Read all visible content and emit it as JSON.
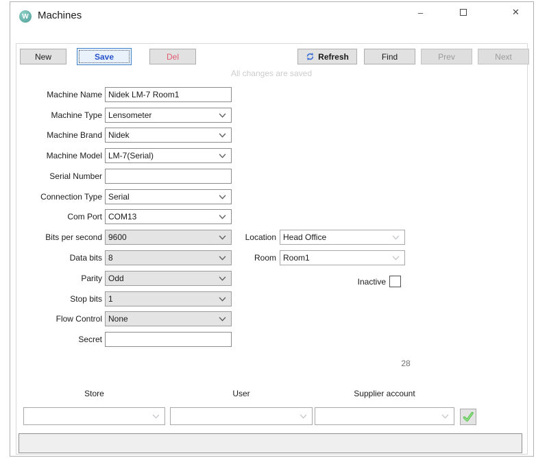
{
  "window": {
    "title": "Machines",
    "icons": {
      "app_logo": "W",
      "minimize_icon": "–",
      "maximize_icon": "empty-square",
      "close_icon": "✕"
    }
  },
  "toolbar": {
    "new_label": "New",
    "save_label": "Save",
    "del_label": "Del",
    "refresh_label": "Refresh",
    "find_label": "Find",
    "prev_label": "Prev",
    "next_label": "Next",
    "status_text": "All changes are saved"
  },
  "form": {
    "rows": [
      {
        "label": "Machine Name",
        "value": "Nidek LM-7 Room1",
        "kind": "text"
      },
      {
        "label": "Machine Type",
        "value": "Lensometer",
        "kind": "combo"
      },
      {
        "label": "Machine Brand",
        "value": "Nidek",
        "kind": "combo"
      },
      {
        "label": "Machine Model",
        "value": "LM-7(Serial)",
        "kind": "combo"
      },
      {
        "label": "Serial Number",
        "value": "",
        "kind": "text"
      },
      {
        "label": "Connection Type",
        "value": "Serial",
        "kind": "combo"
      },
      {
        "label": "Com Port",
        "value": "COM13",
        "kind": "combo"
      },
      {
        "label": "Bits per second",
        "value": "9600",
        "kind": "combo-gray"
      },
      {
        "label": "Data bits",
        "value": "8",
        "kind": "combo-gray"
      },
      {
        "label": "Parity",
        "value": "Odd",
        "kind": "combo-gray"
      },
      {
        "label": "Stop bits",
        "value": "1",
        "kind": "combo-gray"
      },
      {
        "label": "Flow Control",
        "value": "None",
        "kind": "combo-gray"
      },
      {
        "label": "Secret",
        "value": "",
        "kind": "text"
      }
    ],
    "location": {
      "label": "Location",
      "value": "Head Office"
    },
    "room": {
      "label": "Room",
      "value": "Room1"
    },
    "inactive": {
      "label": "Inactive",
      "checked": false
    },
    "record_count": "28"
  },
  "assignments": {
    "store": {
      "label": "Store",
      "value": ""
    },
    "user": {
      "label": "User",
      "value": ""
    },
    "supplier": {
      "label": "Supplier account",
      "value": ""
    },
    "apply_icon": "green-checkmark"
  },
  "colors": {
    "accent_blue": "#2653cc",
    "delete_red": "#e25a6e",
    "refresh_icon_blue": "#3a6fd8",
    "app_icon_teal": "#4d9e97",
    "check_green": "#4bbf3f",
    "status_gray": "#cccccc"
  }
}
